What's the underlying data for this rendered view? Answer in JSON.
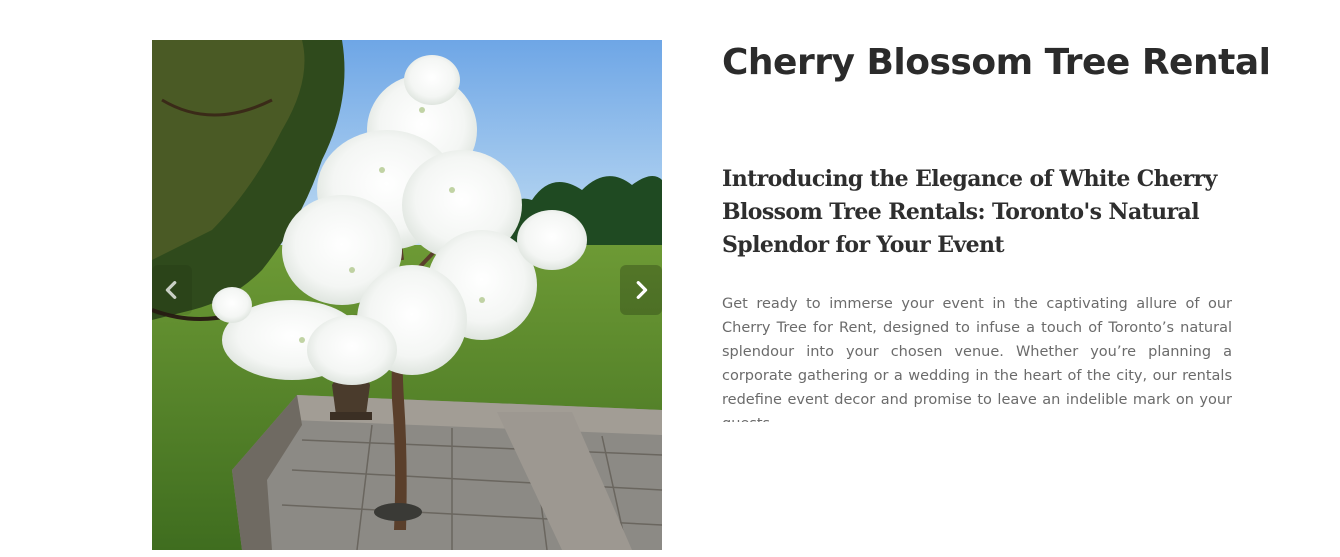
{
  "product": {
    "title": "Cherry Blossom Tree Rental",
    "subtitle": "Introducing the Elegance of White Cherry Blossom Tree Rentals: Toronto's Natural Splendor for Your Event",
    "description": "Get ready to immerse your event in the captivating allure of our Cherry Tree for Rent, designed to infuse a touch of Toronto’s natural splendour into your chosen venue. Whether you’re planning a corporate gathering or a wedding in the heart of the city, our rentals redefine event decor and promise to leave an indelible mark on your guests."
  },
  "carousel": {
    "prev_icon": "chevron-left-icon",
    "next_icon": "chevron-right-icon"
  },
  "colors": {
    "title": "#2b2b2b",
    "body": "#6b6b6b",
    "background": "#ffffff"
  }
}
